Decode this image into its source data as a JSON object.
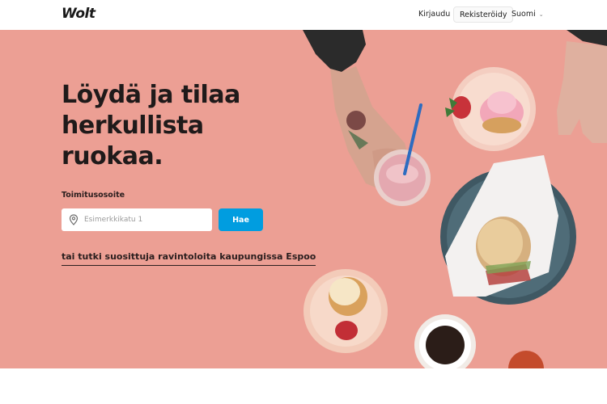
{
  "header": {
    "logo": "Wolt",
    "login_label": "Kirjaudu",
    "register_label": "Rekisteröidy",
    "language_label": "Suomi"
  },
  "hero": {
    "headline_lines": [
      "Löydä ja tilaa",
      "herkullista",
      "ruokaa."
    ],
    "address_label": "Toimitusosoite",
    "address_placeholder": "Esimerkkikatu 1",
    "address_value": "",
    "search_label": "Hae",
    "explore_link": "tai tutki suosittuja ravintoloita kaupungissa Espoo"
  },
  "colors": {
    "hero_background": "#ec9f94",
    "accent": "#009de0"
  },
  "icons": [
    "location-pin-icon",
    "chevron-down-icon"
  ]
}
